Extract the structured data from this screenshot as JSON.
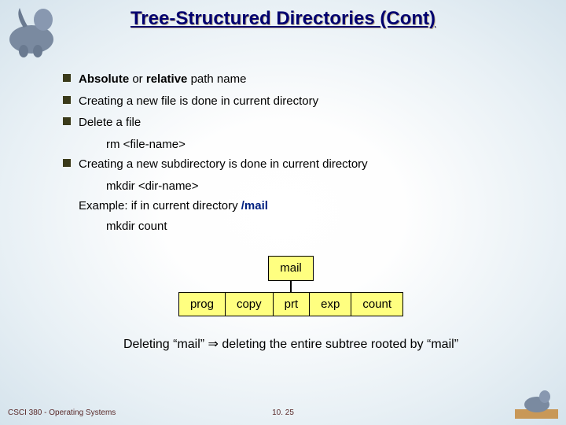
{
  "title": "Tree-Structured Directories (Cont)",
  "bullets": {
    "b1_bold1": "Absolute",
    "b1_mid": " or ",
    "b1_bold2": "relative",
    "b1_rest": " path name",
    "b2": "Creating a new file is done in current directory",
    "b3": "Delete a file",
    "b3_cmd": "rm <file-name>",
    "b4": "Creating a new subdirectory is done in current directory",
    "b4_cmd": "mkdir <dir-name>",
    "ex_label": "Example:  if in current directory   ",
    "ex_path": "/mail",
    "ex_cmd": "mkdir count"
  },
  "tree": {
    "root": "mail",
    "children": [
      "prog",
      "copy",
      "prt",
      "exp",
      "count"
    ]
  },
  "closing": "Deleting “mail” ⇒ deleting the entire subtree rooted by “mail”",
  "footer": {
    "left": "CSCI 380 - Operating Systems",
    "center": "10. 25"
  }
}
